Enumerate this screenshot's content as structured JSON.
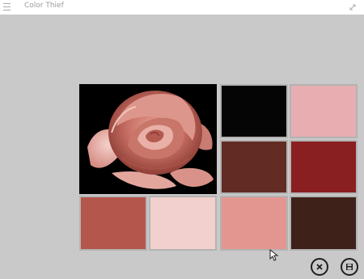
{
  "window": {
    "title": "Color Thief"
  },
  "icons": {
    "menu": "hamburger-menu-icon",
    "expand": "expand-arrows-icon",
    "close": "close-x-icon",
    "save": "floppy-disk-icon"
  },
  "palette": [
    {
      "color": "#050505"
    },
    {
      "color": "#e7adb0"
    },
    {
      "color": "#622c24"
    },
    {
      "color": "#8a1f22"
    },
    {
      "color": "#b4564b"
    },
    {
      "color": "#f2d0cd"
    },
    {
      "color": "#e39690"
    },
    {
      "color": "#3e2119"
    }
  ]
}
